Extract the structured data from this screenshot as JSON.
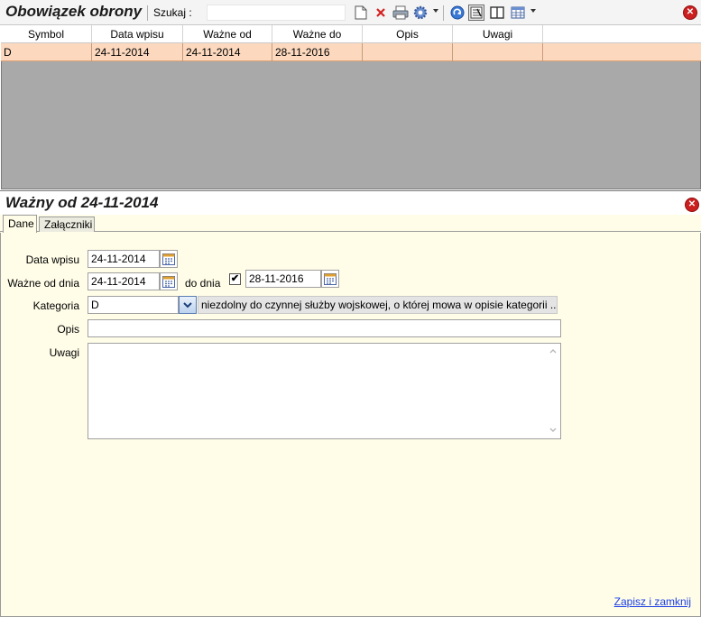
{
  "toolbar": {
    "title": "Obowiązek obrony",
    "search_label": "Szukaj  :",
    "search_value": "",
    "icons": [
      "new-document-icon",
      "delete-icon",
      "print-icon",
      "settings-icon",
      "refresh-icon",
      "filter-icon",
      "columns-icon",
      "grid-layout-icon",
      "close-icon"
    ]
  },
  "grid": {
    "columns": [
      "Symbol",
      "Data wpisu",
      "Ważne od",
      "Ważne do",
      "Opis",
      "Uwagi"
    ],
    "rows": [
      [
        "D",
        "24-11-2014",
        "24-11-2014",
        "28-11-2016",
        "",
        ""
      ]
    ]
  },
  "detail": {
    "title": "Ważny od 24-11-2014",
    "tabs": [
      "Dane",
      "Załączniki"
    ],
    "active_tab": "Dane",
    "form": {
      "data_wpisu_label": "Data wpisu",
      "data_wpisu_value": "24-11-2014",
      "wazne_od_label": "Ważne od dnia",
      "wazne_od_value": "24-11-2014",
      "do_dnia_label": "do dnia",
      "do_dnia_checked": "✔",
      "do_dnia_value": "28-11-2016",
      "kategoria_label": "Kategoria",
      "kategoria_value": "D",
      "kategoria_desc": "niezdolny do czynnej służby wojskowej, o której mowa w opisie kategorii   ...",
      "opis_label": "Opis",
      "opis_value": "",
      "uwagi_label": "Uwagi",
      "uwagi_value": ""
    },
    "save_link": "Zapisz i zamknij"
  },
  "colors": {
    "selected_row": "#fcd9be",
    "grid_bg": "#a9a9a9",
    "panel_bg": "#fffde8",
    "close_red": "#cc1f1f",
    "link_blue": "#1a3ee6"
  }
}
